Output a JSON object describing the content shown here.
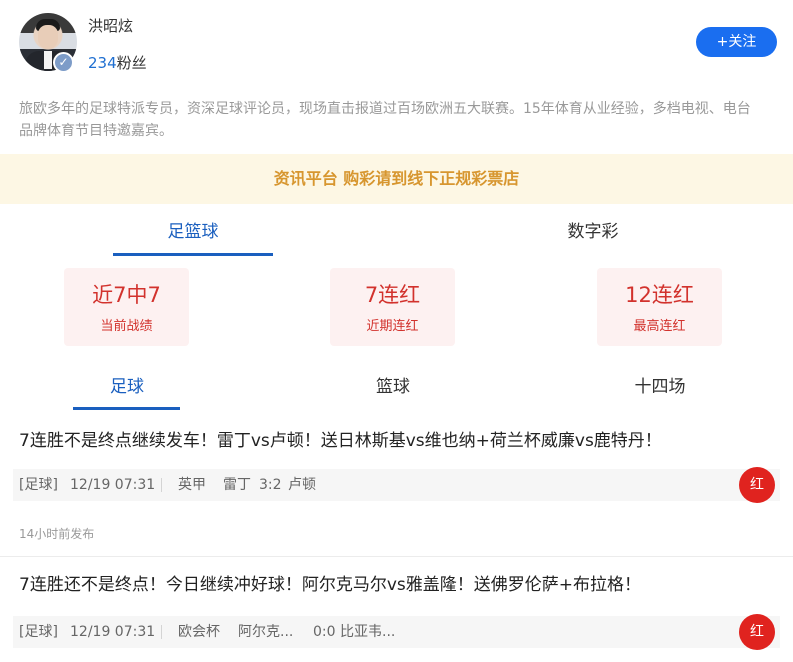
{
  "author": {
    "name": "洪昭炫",
    "fans_count": "234",
    "fans_suffix": "粉丝",
    "follow_label": "+关注",
    "verify_icon": "✓"
  },
  "bio": "旅欧多年的足球特派专员，资深足球评论员，现场直击报道过百场欧洲五大联赛。15年体育从业经验，多档电视、电台品牌体育节目特邀嘉宾。",
  "notice": "资讯平台 购彩请到线下正规彩票店",
  "main_tabs": [
    {
      "label": "足篮球",
      "active": true
    },
    {
      "label": "数字彩",
      "active": false
    }
  ],
  "stats": [
    {
      "value": "近7中7",
      "label": "当前战绩"
    },
    {
      "value": "7连红",
      "label": "近期连红"
    },
    {
      "value": "12连红",
      "label": "最高连红"
    }
  ],
  "sub_tabs": [
    {
      "label": "足球",
      "active": true
    },
    {
      "label": "篮球",
      "active": false
    },
    {
      "label": "十四场",
      "active": false
    }
  ],
  "articles": [
    {
      "title": "7连胜不是终点继续发车！雷丁vs卢顿！送日林斯基vs维也纳+荷兰杯威廉vs鹿特丹！",
      "category": "[足球]",
      "datetime": "12/19 07:31",
      "league": "英甲",
      "home": "雷丁",
      "score": "3:2",
      "away": "卢顿",
      "result": "红",
      "published": "14小时前发布"
    },
    {
      "title": "7连胜还不是终点！今日继续冲好球！阿尔克马尔vs雅盖隆！送佛罗伦萨+布拉格！",
      "category": "[足球]",
      "datetime": "12/19 07:31",
      "league": "欧会杯",
      "home": "阿尔克...",
      "score": "0:0",
      "away": "比亚韦...",
      "result": "红"
    }
  ],
  "colors": {
    "accent_blue": "#1a5fbf",
    "follow_blue": "#1a6ef0",
    "red": "#d2322d",
    "notice_bg": "#fdf7e4",
    "notice_text": "#d7962f"
  }
}
